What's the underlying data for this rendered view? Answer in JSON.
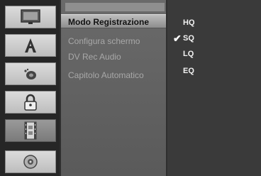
{
  "icons": [
    {
      "name": "tv-monitor-icon"
    },
    {
      "name": "language-a-icon"
    },
    {
      "name": "audio-icon"
    },
    {
      "name": "lock-icon"
    },
    {
      "name": "recording-film-icon",
      "selected": true
    },
    {
      "name": "disc-icon"
    }
  ],
  "menu": {
    "items": [
      {
        "label": "Modo Registrazione",
        "selected": true
      },
      {
        "label": "Configura schermo"
      },
      {
        "label": "DV Rec Audio"
      },
      {
        "label": "Capitolo Automatico"
      }
    ]
  },
  "options": {
    "items": [
      {
        "label": "HQ"
      },
      {
        "label": "SQ",
        "checked": true,
        "check_mark": "✔"
      },
      {
        "label": "LQ"
      },
      {
        "label": "EQ"
      }
    ]
  },
  "colors": {
    "background": "#2f2f2f",
    "menu_bg": "#5f5f5f",
    "selected_menu": "#a8a8a8",
    "text_dim": "#a8a8a8",
    "text_bright": "#f2f2f2"
  }
}
